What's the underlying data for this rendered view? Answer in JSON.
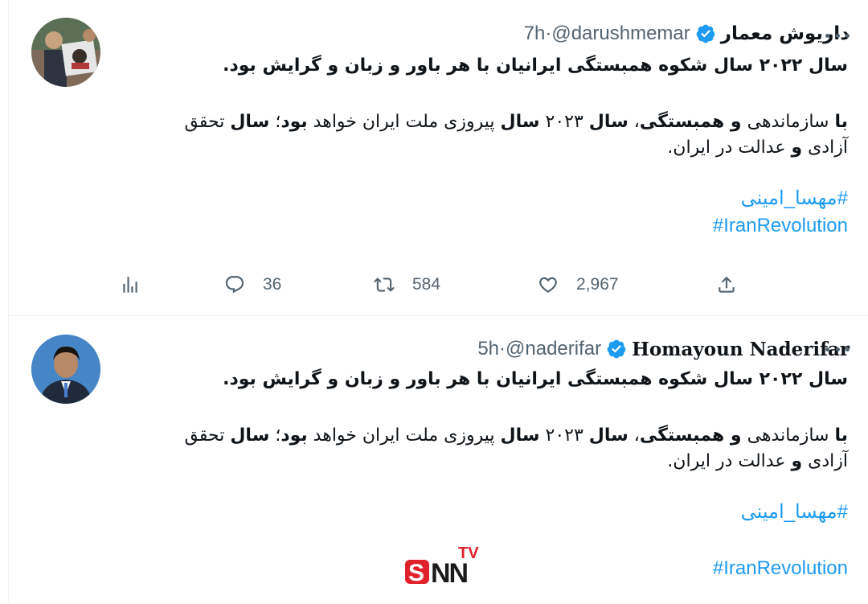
{
  "tweets": [
    {
      "display_name": "داریوش معمار",
      "handle": "@darushmemar",
      "time": "7h",
      "text_line1": "سال ۲۰۲۲ سال شکوه همبستگی ایرانیان با هر باور و زبان و گرایش بود.",
      "p2_line1": {
        "a": "با",
        "b": " سازماندهی ",
        "c": "و همبستگی",
        "d": "، ",
        "e": "سال",
        "f": " ۲۰۲۳ ",
        "g": "سال",
        "h": " پیروزی ملت ایران خواهد ",
        "i": "بود",
        "j": "؛ ",
        "k": "سال",
        "l": " تحقق"
      },
      "p2_line2": {
        "a": "آزادی ",
        "b": "و",
        "c": " عدالت در ایران."
      },
      "hashtags": [
        "#مهسا_امینی",
        "#IranRevolution"
      ],
      "actions": {
        "views": "",
        "replies": "36",
        "retweets": "584",
        "likes": "2,967"
      }
    },
    {
      "display_name": "Homayoun Naderifar",
      "handle": "@naderifar",
      "time": "5h",
      "text_line1": "سال ۲۰۲۲ سال شکوه همبستگی ایرانیان با هر باور و زبان و گرایش بود.",
      "p2_line1": {
        "a": "با",
        "b": " سازماندهی ",
        "c": "و همبستگی",
        "d": "، ",
        "e": "سال",
        "f": " ۲۰۲۳ ",
        "g": "سال",
        "h": " پیروزی ملت ایران خواهد ",
        "i": "بود",
        "j": "؛ ",
        "k": "سال",
        "l": " تحقق"
      },
      "p2_line2": {
        "a": "آزادی ",
        "b": "و",
        "c": " عدالت در ایران."
      },
      "hashtags": [
        "#مهسا_امینی",
        "#IranRevolution"
      ]
    }
  ],
  "separator": " · ",
  "watermark": {
    "top": "TV",
    "main": "SNN"
  },
  "colors": {
    "link": "#1d9bf0",
    "verified": "#1d9bf0",
    "muted": "#536471",
    "watermark_red": "#e0202b"
  },
  "icons": [
    "verified-badge-icon",
    "more-icon",
    "analytics-icon",
    "reply-icon",
    "retweet-icon",
    "like-icon",
    "share-icon"
  ]
}
